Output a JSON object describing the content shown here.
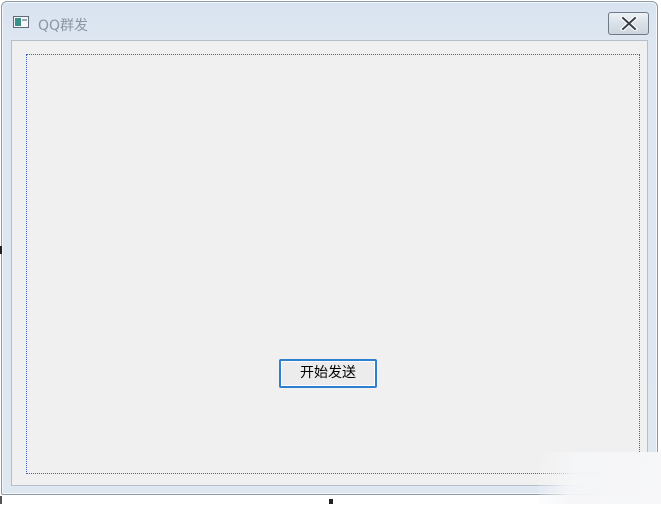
{
  "window": {
    "title": "QQ群发",
    "icon": "app-window-icon",
    "close_icon": "close-icon"
  },
  "main": {
    "start_button_label": "开始发送"
  },
  "colors": {
    "client_background": "#f0f0f0",
    "group_box_border": "#3a62c4",
    "button_focus_border": "#2f7fd1",
    "title_text": "#8a96a3"
  }
}
